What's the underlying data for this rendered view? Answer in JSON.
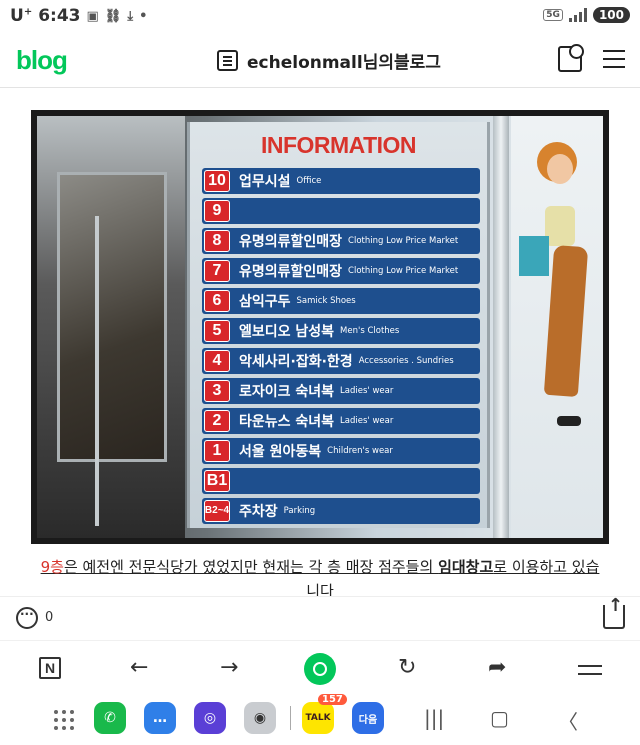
{
  "status_bar": {
    "carrier": "U",
    "carrier_sup": "+",
    "time": "6:43",
    "network": "5G",
    "battery": "100"
  },
  "header": {
    "logo": "blog",
    "blog_title": "echelonmall님의블로그"
  },
  "photo": {
    "board_title": "INFORMATION",
    "floors": [
      {
        "badge": "10",
        "ko": "업무시설",
        "en": "Office"
      },
      {
        "badge": "9",
        "ko": "",
        "en": ""
      },
      {
        "badge": "8",
        "ko": "유명의류할인매장",
        "en": "Clothing Low Price Market"
      },
      {
        "badge": "7",
        "ko": "유명의류할인매장",
        "en": "Clothing Low Price Market"
      },
      {
        "badge": "6",
        "ko": "삼익구두",
        "en": "Samick Shoes"
      },
      {
        "badge": "5",
        "ko": "엘보디오 남성복",
        "en": "Men's Clothes"
      },
      {
        "badge": "4",
        "ko": "악세사리·잡화·한경",
        "en": "Accessories . Sundries"
      },
      {
        "badge": "3",
        "ko": "로자이크 숙녀복",
        "en": "Ladies' wear"
      },
      {
        "badge": "2",
        "ko": "타운뉴스 숙녀복",
        "en": "Ladies' wear"
      },
      {
        "badge": "1",
        "ko": "서울 원아동복",
        "en": "Children's wear"
      },
      {
        "badge": "B1",
        "ko": "",
        "en": ""
      },
      {
        "badge": "B2~4",
        "ko": "주차장",
        "en": "Parking"
      }
    ]
  },
  "caption": {
    "part1": "9층",
    "part2": "은 예전엔 전문식당가 였었지만 현재는 각 층 매장 점주들의 ",
    "part3": "임대창고",
    "part4": "로 이용하고 있습",
    "line2": "니다"
  },
  "actions": {
    "comment_count": "0"
  },
  "toolbar": {
    "n_label": "N"
  },
  "navbar": {
    "kakao_badge": "157",
    "talk_label": "TALK",
    "knav_label": "다음"
  },
  "colors": {
    "brand_green": "#03c75a",
    "board_blue": "#1e4f8e",
    "badge_red": "#d8262a"
  }
}
